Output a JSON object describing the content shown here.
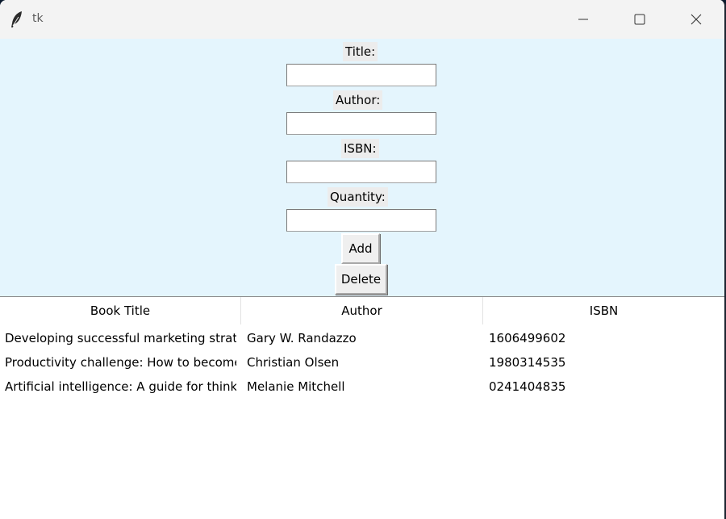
{
  "window": {
    "title": "tk"
  },
  "form": {
    "title_label": "Title:",
    "author_label": "Author:",
    "isbn_label": "ISBN:",
    "quantity_label": "Quantity:",
    "title_value": "",
    "author_value": "",
    "isbn_value": "",
    "quantity_value": "",
    "add_label": "Add",
    "delete_label": "Delete"
  },
  "table": {
    "columns": [
      "Book Title",
      "Author",
      "ISBN"
    ],
    "rows": [
      [
        "Developing successful marketing strategies",
        "Gary W. Randazzo",
        "1606499602"
      ],
      [
        "Productivity challenge: How to become",
        "Christian Olsen",
        "1980314535"
      ],
      [
        "Artificial intelligence: A guide for thinking humans",
        "Melanie Mitchell",
        "0241404835"
      ]
    ]
  },
  "icons": {
    "app": "feather-icon",
    "minimize": "minimize-icon",
    "maximize": "maximize-icon",
    "close": "close-icon"
  },
  "colors": {
    "form_background": "#e4f5fd",
    "titlebar_background": "#f3f3f3",
    "table_background": "#ffffff"
  }
}
